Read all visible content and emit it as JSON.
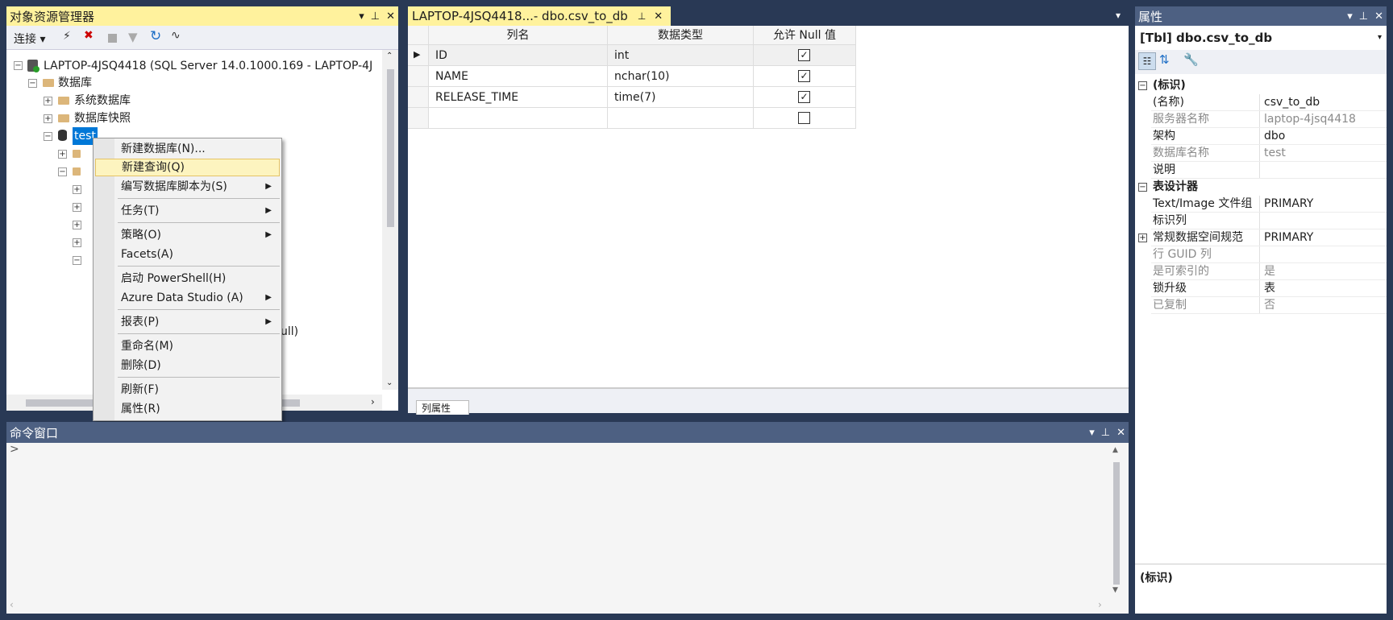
{
  "object_explorer": {
    "title": "对象资源管理器",
    "toolbar_connect": "连接",
    "tree": {
      "server": "LAPTOP-4JSQ4418 (SQL Server 14.0.1000.169 - LAPTOP-4J",
      "databases": "数据库",
      "system_databases": "系统数据库",
      "snapshots": "数据库快照",
      "test_db": "test",
      "partial_row_ull": "ull)"
    }
  },
  "context_menu": {
    "items": [
      {
        "label": "新建数据库(N)..."
      },
      {
        "label": "新建查询(Q)"
      },
      {
        "label": "编写数据库脚本为(S)"
      },
      {
        "label": "任务(T)"
      },
      {
        "label": "策略(O)"
      },
      {
        "label": "Facets(A)"
      },
      {
        "label": "启动 PowerShell(H)"
      },
      {
        "label": "Azure Data Studio (A)"
      },
      {
        "label": "报表(P)"
      },
      {
        "label": "重命名(M)"
      },
      {
        "label": "删除(D)"
      },
      {
        "label": "刷新(F)"
      },
      {
        "label": "属性(R)"
      }
    ]
  },
  "editor": {
    "tab_title": "LAPTOP-4JSQ4418...- dbo.csv_to_db",
    "columns_header": [
      "列名",
      "数据类型",
      "允许 Null 值"
    ],
    "rows": [
      {
        "name": "ID",
        "type": "int",
        "nullable": "✓"
      },
      {
        "name": "NAME",
        "type": "nchar(10)",
        "nullable": "✓"
      },
      {
        "name": "RELEASE_TIME",
        "type": "time(7)",
        "nullable": "✓"
      },
      {
        "name": "",
        "type": "",
        "nullable": ""
      }
    ],
    "bottom_tab": "列属性"
  },
  "command_window": {
    "title": "命令窗口",
    "prompt": ">"
  },
  "properties": {
    "title": "属性",
    "object": "[Tbl] dbo.csv_to_db",
    "section_identity": "(标识)",
    "identity_rows": [
      {
        "name": "(名称)",
        "value": "csv_to_db",
        "gray": false
      },
      {
        "name": "服务器名称",
        "value": "laptop-4jsq4418",
        "gray": true
      },
      {
        "name": "架构",
        "value": "dbo",
        "gray": false
      },
      {
        "name": "数据库名称",
        "value": "test",
        "gray": true
      },
      {
        "name": "说明",
        "value": "",
        "gray": false
      }
    ],
    "section_designer": "表设计器",
    "designer_rows": [
      {
        "name": "Text/Image 文件组",
        "value": "PRIMARY",
        "gray": false
      },
      {
        "name": "标识列",
        "value": "",
        "gray": false
      },
      {
        "name": "常规数据空间规范",
        "value": "PRIMARY",
        "gray": false
      },
      {
        "name": "行 GUID 列",
        "value": "",
        "gray": true
      },
      {
        "name": "是可索引的",
        "value": "是",
        "gray": true
      },
      {
        "name": "锁升级",
        "value": "表",
        "gray": false
      },
      {
        "name": "已复制",
        "value": "否",
        "gray": true
      }
    ],
    "description_title": "(标识)"
  }
}
